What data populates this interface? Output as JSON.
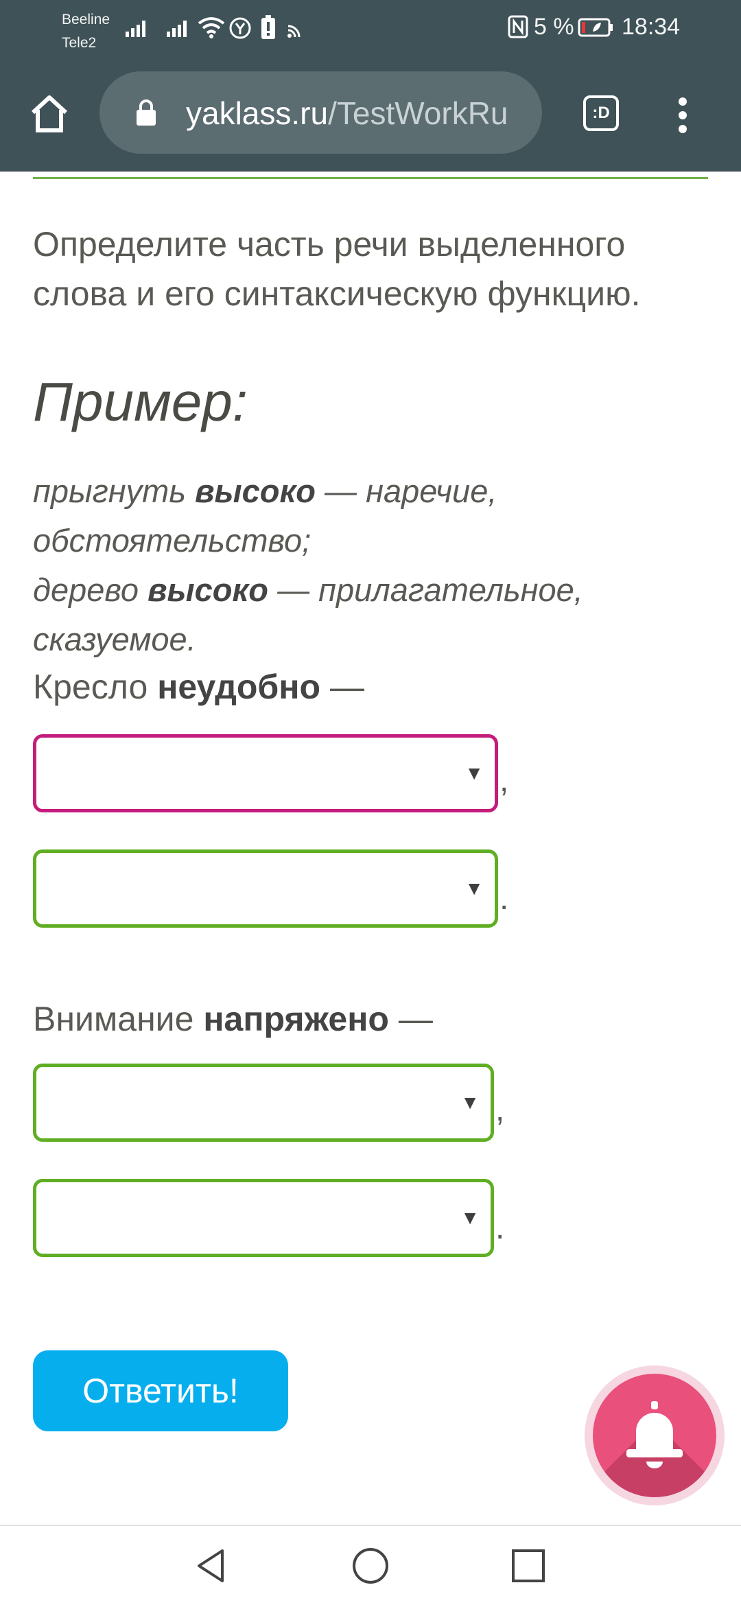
{
  "status_bar": {
    "carrier_1": "Beeline",
    "carrier_2": "Tele2",
    "battery_percent": "5 %",
    "time": "18:34",
    "icons": [
      "signal-icon",
      "signal-icon",
      "wifi-icon",
      "yandex-icon",
      "battery-saver-icon",
      "cast-icon",
      "nfc-icon",
      "battery-icon"
    ]
  },
  "browser": {
    "url_domain": "yaklass.ru",
    "url_path": "/TestWorkRu",
    "tabs_label": ":D",
    "icons": [
      "home-icon",
      "lock-icon",
      "tabs-icon",
      "more-vert-icon"
    ]
  },
  "task": {
    "instruction": "Определите часть речи выделенного слова и его синтаксическую функцию.",
    "example_title": "Пример:",
    "example_1_word": "прыгнуть",
    "example_1_bold": "высоко",
    "example_1_rest": "— наречие, обстоятельство;",
    "example_2_word": "дерево",
    "example_2_bold": "высоко",
    "example_2_rest": "— прилагательное, сказуемое."
  },
  "questions": [
    {
      "prefix": "Кресло",
      "bold": "неудобно",
      "dash": "—",
      "select_1_value": "",
      "select_1_sep": ",",
      "select_2_value": "",
      "select_2_sep": "."
    },
    {
      "prefix": "Внимание",
      "bold": "напряжено",
      "dash": "—",
      "select_1_value": "",
      "select_1_sep": ",",
      "select_2_value": "",
      "select_2_sep": "."
    }
  ],
  "answer_button": "Ответить!",
  "colors": {
    "chrome": "#3f5257",
    "accent_green": "#5fae23",
    "error_pink": "#c41c7c",
    "button_blue": "#07aeee",
    "bell_pink": "#e9507b"
  },
  "nav": {
    "icons": [
      "back-icon",
      "home-circle-icon",
      "recents-icon"
    ]
  }
}
